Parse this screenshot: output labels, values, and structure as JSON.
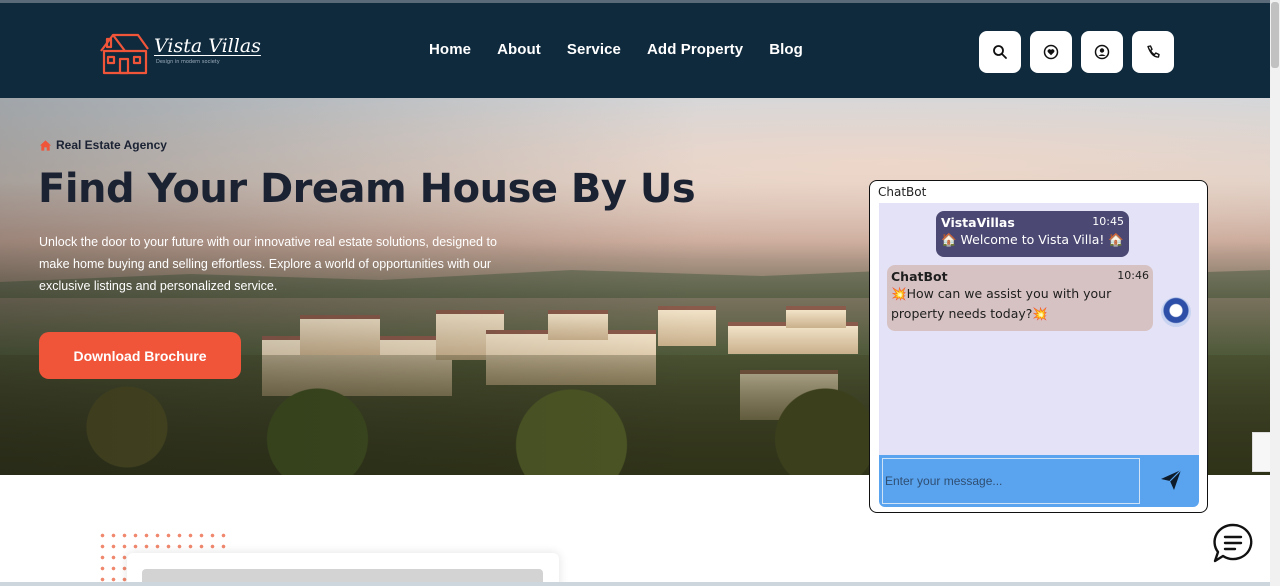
{
  "brand": {
    "name": "Vista Villas",
    "tagline": "Design in modern society"
  },
  "nav": {
    "items": [
      "Home",
      "About",
      "Service",
      "Add Property",
      "Blog"
    ]
  },
  "header_icons": [
    "search-icon",
    "heart-icon",
    "user-icon",
    "phone-icon"
  ],
  "hero": {
    "badge": "Real Estate Agency",
    "title": "Find Your Dream House By Us",
    "description": "Unlock the door to your future with our innovative real estate solutions, designed to make home buying and selling effortless. Explore a world of opportunities with our exclusive listings and personalized service.",
    "button_label": "Download Brochure"
  },
  "chatbot": {
    "title": "ChatBot",
    "messages": [
      {
        "sender": "VistaVillas",
        "time": "10:45",
        "text": "🏠 Welcome to Vista Villa! 🏠"
      },
      {
        "sender": "ChatBot",
        "time": "10:46",
        "text": "💥How can we assist you with your property needs today?💥"
      }
    ],
    "input_placeholder": "Enter your message..."
  },
  "colors": {
    "header_bg": "#0f2a3d",
    "accent": "#f0553a",
    "chat_bg": "#e4e2f6",
    "chat_input_bg": "#5aa3ef",
    "bot_welcome_bg": "#4b4873",
    "bot_reply_bg": "#d7c2c3"
  }
}
